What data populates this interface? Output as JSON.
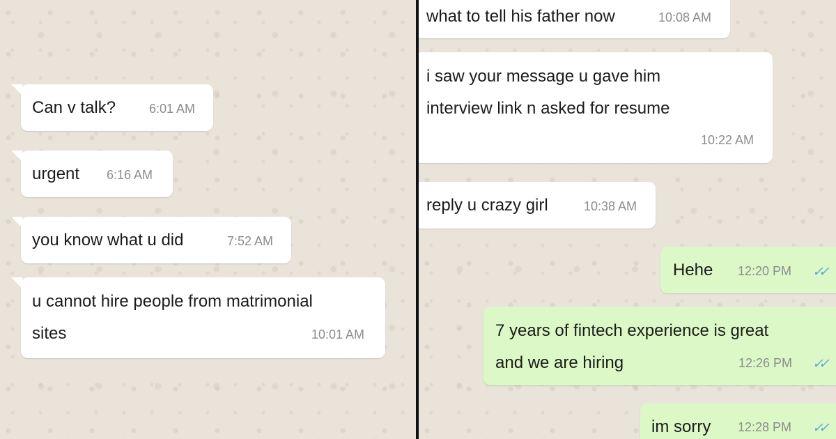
{
  "left_panel": {
    "messages": [
      {
        "text": "Can v talk?",
        "time": "6:01 AM"
      },
      {
        "text": "urgent",
        "time": "6:16 AM"
      },
      {
        "text": "you know what u did",
        "time": "7:52 AM"
      },
      {
        "lines": [
          "u cannot hire people from matrimonial",
          "sites"
        ],
        "time": "10:01 AM"
      }
    ]
  },
  "right_panel": {
    "messages": [
      {
        "text": "what to tell his father now",
        "time": "10:08 AM"
      },
      {
        "lines": [
          "i saw your message u gave him",
          "interview link n asked for resume"
        ],
        "time": "10:22 AM"
      },
      {
        "text": "reply u crazy girl",
        "time": "10:38 AM"
      },
      {
        "text": "Hehe",
        "time": "12:20 PM",
        "ticks": "✓✓"
      },
      {
        "lines": [
          "7 years of fintech experience is great",
          "and we are hiring"
        ],
        "time": "12:26 PM",
        "ticks": "✓✓"
      },
      {
        "text": "im sorry",
        "time": "12:28 PM",
        "ticks": "✓✓"
      }
    ]
  },
  "colors": {
    "wallpaper": "#e9e3da",
    "incoming_bubble": "#ffffff",
    "outgoing_bubble": "#dcf8c6",
    "timestamp": "#8c8c8c",
    "read_ticks": "#5aa6d9",
    "divider": "#111111"
  },
  "icons": {
    "read_receipt": "double-check-icon"
  }
}
